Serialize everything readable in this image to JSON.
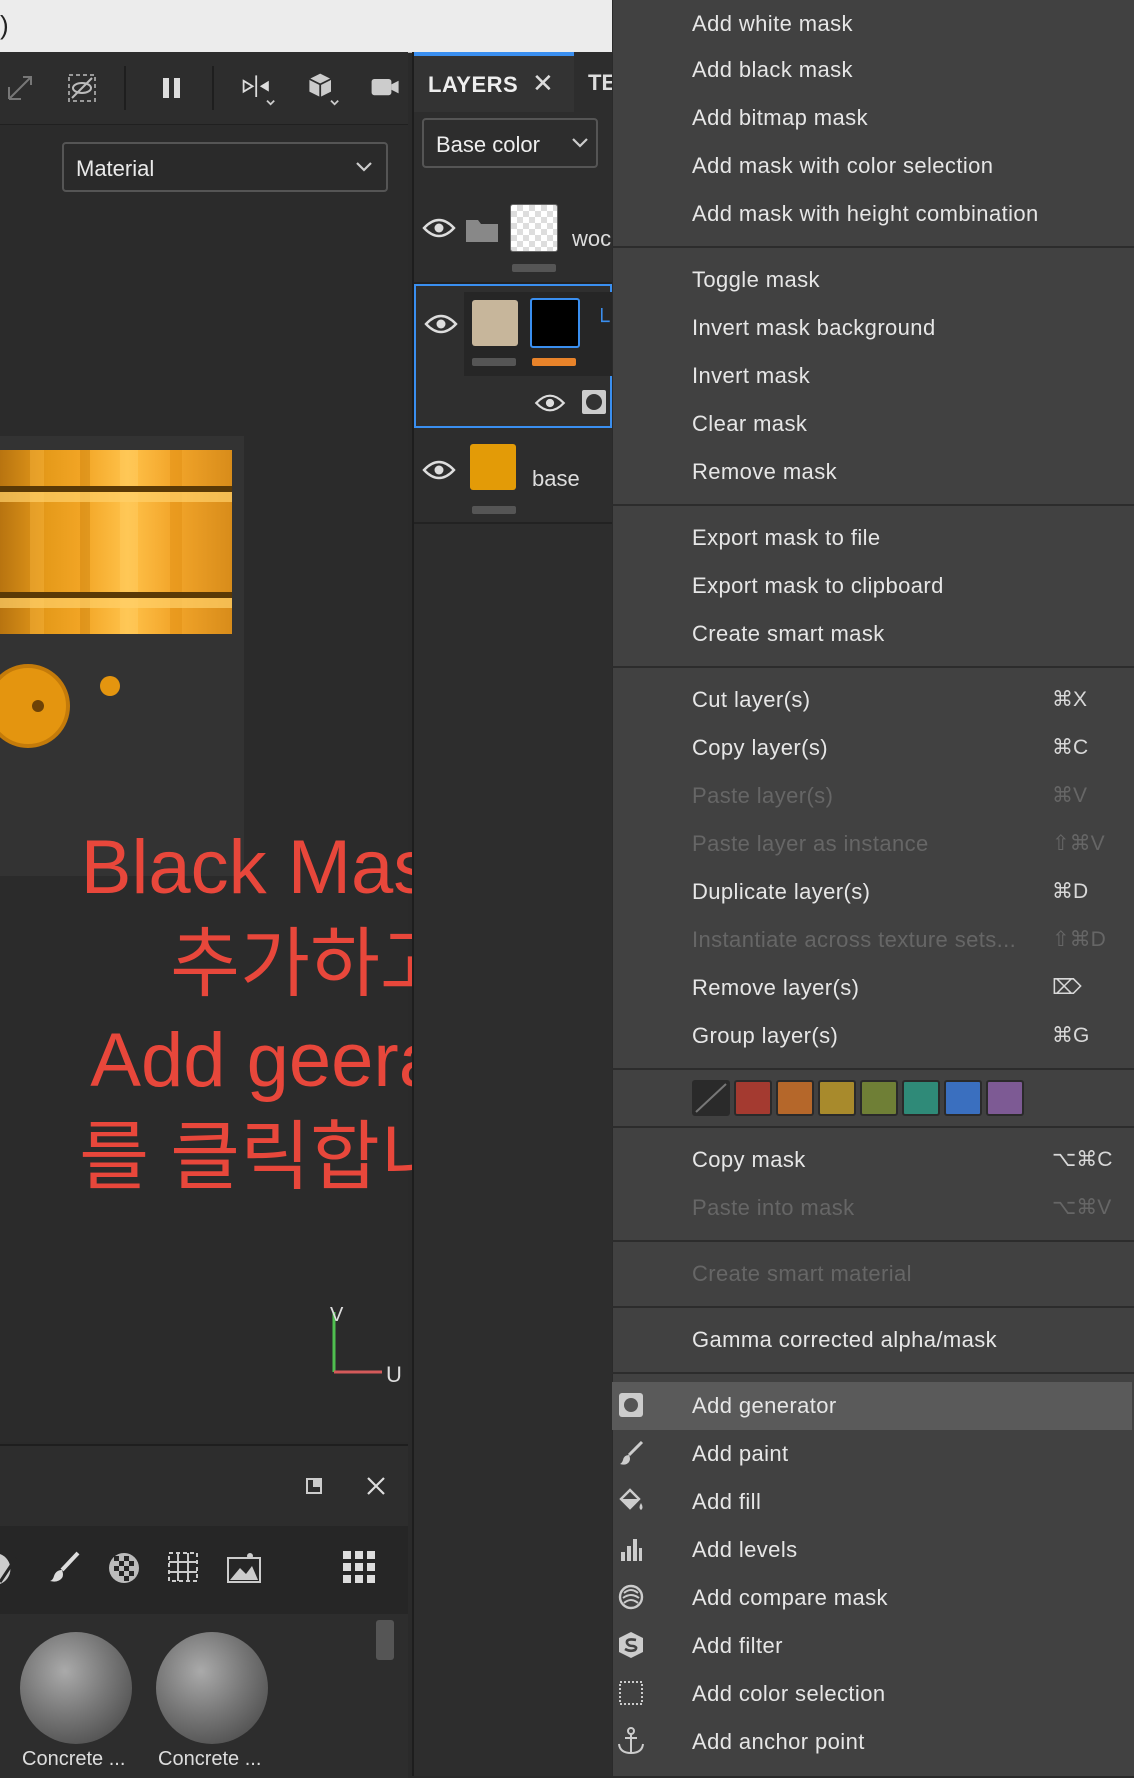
{
  "topbar": {
    "fragment": ")"
  },
  "viewport": {
    "material_select": "Material",
    "annotation": [
      "Black Mask를",
      "추가하고",
      "Add geerator",
      "를 클릭합니다."
    ],
    "axis_v": "V",
    "axis_u": "U"
  },
  "dock": {
    "materials": [
      {
        "label": "Concrete ..."
      },
      {
        "label": "Concrete ..."
      }
    ]
  },
  "layers": {
    "tab_label": "LAYERS",
    "next_tab": "TE",
    "channel_select": "Base color",
    "rows": [
      {
        "name": "woc"
      },
      {
        "name": ""
      },
      {
        "name": "base"
      }
    ]
  },
  "menu": {
    "group1": [
      "Add white mask",
      "Add black mask",
      "Add bitmap mask",
      "Add mask with color selection",
      "Add mask with height combination"
    ],
    "group2": [
      "Toggle mask",
      "Invert mask background",
      "Invert mask",
      "Clear mask",
      "Remove mask"
    ],
    "group3": [
      "Export mask to file",
      "Export mask to clipboard",
      "Create smart mask"
    ],
    "group4": [
      {
        "label": "Cut layer(s)",
        "shortcut": "⌘X"
      },
      {
        "label": "Copy layer(s)",
        "shortcut": "⌘C"
      },
      {
        "label": "Paste layer(s)",
        "shortcut": "⌘V"
      },
      {
        "label": "Paste layer as instance",
        "shortcut": "⇧⌘V"
      },
      {
        "label": "Duplicate layer(s)",
        "shortcut": "⌘D"
      },
      {
        "label": "Instantiate across texture sets...",
        "shortcut": "⇧⌘D"
      },
      {
        "label": "Remove layer(s)",
        "shortcut": "⌦"
      },
      {
        "label": "Group layer(s)",
        "shortcut": "⌘G"
      }
    ],
    "swatch_colors": [
      "#2a2a2a",
      "#a43a30",
      "#b5672a",
      "#a88a2c",
      "#6f7f36",
      "#2f8a78",
      "#3a6fbf",
      "#7d5a94"
    ],
    "group5": [
      {
        "label": "Copy mask",
        "shortcut": "⌥⌘C"
      },
      {
        "label": "Paste into mask",
        "shortcut": "⌥⌘V"
      }
    ],
    "create_smart_material": "Create smart material",
    "gamma": "Gamma corrected alpha/mask",
    "group6": [
      {
        "label": "Add generator",
        "icon": "generator-icon"
      },
      {
        "label": "Add paint",
        "icon": "brush-icon"
      },
      {
        "label": "Add fill",
        "icon": "bucket-icon"
      },
      {
        "label": "Add levels",
        "icon": "levels-icon"
      },
      {
        "label": "Add compare mask",
        "icon": "compare-icon"
      },
      {
        "label": "Add filter",
        "icon": "filter-icon"
      },
      {
        "label": "Add color selection",
        "icon": "selection-icon"
      },
      {
        "label": "Add anchor point",
        "icon": "anchor-icon"
      }
    ]
  }
}
